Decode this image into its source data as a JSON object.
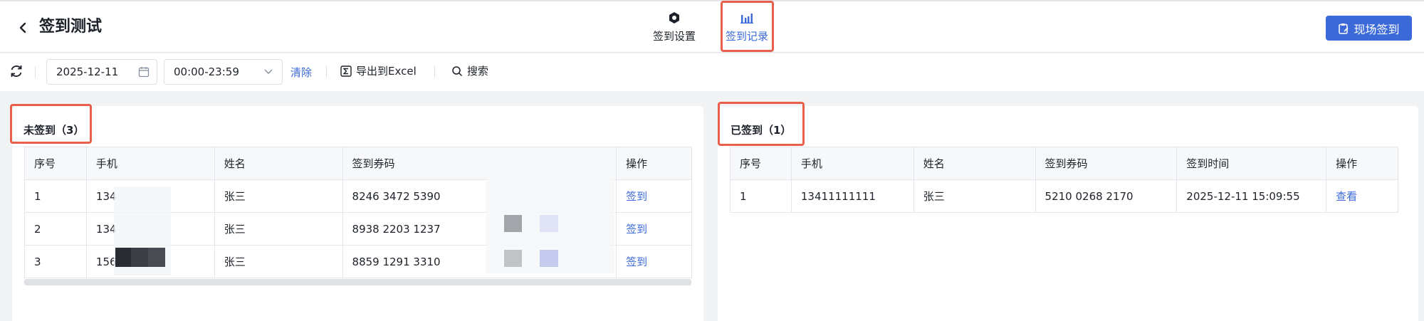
{
  "header": {
    "title": "签到测试",
    "tabs": [
      {
        "label": "签到设置",
        "icon": "hexagon-settings-icon"
      },
      {
        "label": "签到记录",
        "icon": "bar-chart-icon",
        "active": true
      }
    ],
    "onsite_button": "现场签到",
    "accent_color": "#3b6ad8",
    "highlight_color": "#e8604c"
  },
  "toolbar": {
    "date_value": "2025-12-11",
    "time_value": "00:00-23:59",
    "clear_label": "清除",
    "export_label": "导出到Excel",
    "search_label": "搜索"
  },
  "not_signed": {
    "title": "未签到（3）",
    "columns": [
      "序号",
      "手机",
      "姓名",
      "签到券码",
      "操作"
    ],
    "rows": [
      {
        "no": "1",
        "phone": "134",
        "name": "张三",
        "code": "8246 3472 5390",
        "action": "签到"
      },
      {
        "no": "2",
        "phone": "134",
        "name": "张三",
        "code": "8938 2203 1237",
        "action": "签到"
      },
      {
        "no": "3",
        "phone": "156",
        "name": "张三",
        "code": "8859 1291 3310",
        "action": "签到"
      }
    ]
  },
  "signed": {
    "title": "已签到（1）",
    "columns": [
      "序号",
      "手机",
      "姓名",
      "签到券码",
      "签到时间",
      "操作"
    ],
    "rows": [
      {
        "no": "1",
        "phone": "13411111111",
        "name": "张三",
        "code": "5210 0268 2170",
        "time": "2025-12-11 15:09:55",
        "action": "查看"
      }
    ]
  }
}
